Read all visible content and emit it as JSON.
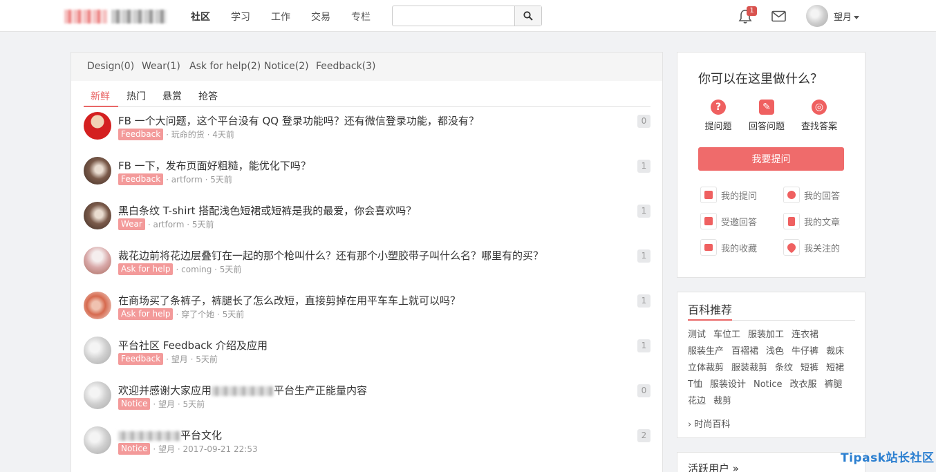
{
  "nav": {
    "items": [
      "社区",
      "学习",
      "工作",
      "交易",
      "专栏"
    ],
    "notification_count": "1",
    "user_name": "望月"
  },
  "search": {
    "placeholder": ""
  },
  "categories": [
    "Design(0)",
    "Wear(1)",
    "Ask for help(2)",
    "Notice(2)",
    "Feedback(3)"
  ],
  "tabs": [
    "新鲜",
    "热门",
    "悬赏",
    "抢答"
  ],
  "questions": [
    {
      "title": "FB 一个大问题，这个平台没有 QQ 登录功能吗？还有微信登录功能，都没有？",
      "tag": "Feedback",
      "author": "玩命的货",
      "time": "4天前",
      "answers": "0"
    },
    {
      "title": "FB 一下，发布页面好粗糙，能优化下吗？",
      "tag": "Feedback",
      "author": "artform",
      "time": "5天前",
      "answers": "1"
    },
    {
      "title": "黑白条纹 T-shirt 搭配浅色短裙或短裤是我的最爱，你会喜欢吗？",
      "tag": "Wear",
      "author": "artform",
      "time": "5天前",
      "answers": "1"
    },
    {
      "title": "裁花边前将花边层叠钉在一起的那个枪叫什么？还有那个小塑胶带子叫什么名？哪里有的买？",
      "tag": "Ask for help",
      "author": "coming",
      "time": "5天前",
      "answers": "1"
    },
    {
      "title": "在商场买了条裤子，裤腿长了怎么改短，直接剪掉在用平车车上就可以吗？",
      "tag": "Ask for help",
      "author": "穿了个她",
      "time": "5天前",
      "answers": "1"
    },
    {
      "title": "平台社区 Feedback 介绍及应用",
      "tag": "Feedback",
      "author": "望月",
      "time": "5天前",
      "answers": "1"
    },
    {
      "title_pre": "欢迎并感谢大家应用",
      "title_post": "平台生产正能量内容",
      "tag": "Notice",
      "author": "望月",
      "time": "5天前",
      "answers": "0"
    },
    {
      "title_post": "平台文化",
      "tag": "Notice",
      "author": "望月",
      "time": "2017-09-21 22:53",
      "answers": "2"
    }
  ],
  "help_card": {
    "title": "你可以在这里做什么？",
    "actions": [
      "提问题",
      "回答问题",
      "查找答案"
    ],
    "ask_button": "我要提问",
    "links": [
      "我的提问",
      "我的回答",
      "受邀回答",
      "我的文章",
      "我的收藏",
      "我关注的"
    ]
  },
  "wiki": {
    "title": "百科推荐",
    "tags": [
      "测试",
      "车位工",
      "服装加工",
      "连衣裙",
      "服装生产",
      "百褶裙",
      "浅色",
      "牛仔裤",
      "裁床",
      "立体裁剪",
      "服装裁剪",
      "条纹",
      "短裤",
      "短裙",
      "T恤",
      "服装设计",
      "Notice",
      "改衣服",
      "裤腿",
      "花边",
      "裁剪"
    ],
    "more": "时尚百科"
  },
  "active_users": {
    "title": "活跃用户 »"
  },
  "watermark": "Tipask站长社区",
  "colors": {
    "accent": "#e96767",
    "tag_bg": "#f39a9a",
    "button": "#ef6b6b"
  }
}
